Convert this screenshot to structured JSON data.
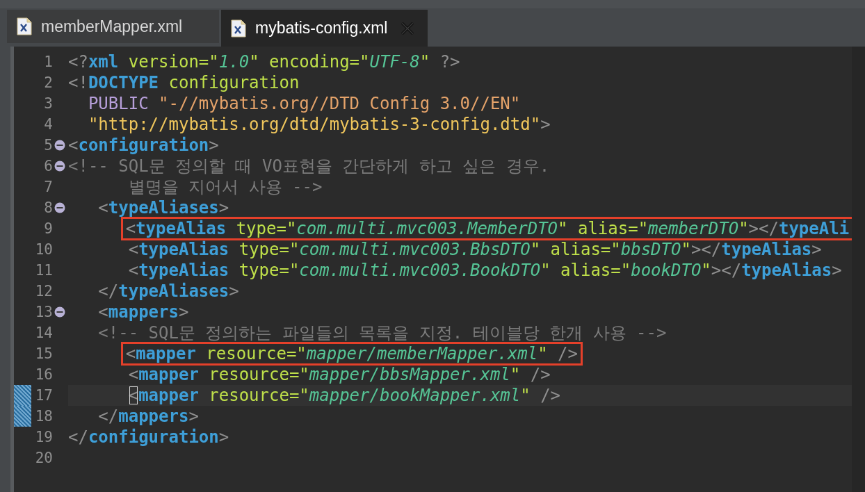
{
  "tabs": [
    {
      "label": "memberMapper.xml",
      "selected": false
    },
    {
      "label": "mybatis-config.xml",
      "selected": true
    }
  ],
  "editor": {
    "lines": [
      {
        "number": "1",
        "tokens": [
          {
            "kind": "punct",
            "text": "<?"
          },
          {
            "kind": "tag",
            "text": "xml"
          },
          {
            "kind": "attr",
            "text": " version=\""
          },
          {
            "kind": "value",
            "text": "1.0"
          },
          {
            "kind": "attr",
            "text": "\" encoding=\""
          },
          {
            "kind": "value",
            "text": "UTF-8"
          },
          {
            "kind": "attr",
            "text": "\""
          },
          {
            "kind": "punct",
            "text": " ?>"
          }
        ]
      },
      {
        "number": "2",
        "tokens": [
          {
            "kind": "punct",
            "text": "<!"
          },
          {
            "kind": "tag",
            "text": "DOCTYPE"
          },
          {
            "kind": "attr",
            "text": " configuration"
          }
        ]
      },
      {
        "number": "3",
        "tokens": [
          {
            "kind": "keyword",
            "text": "  PUBLIC"
          },
          {
            "kind": "pubid",
            "text": " \"-//mybatis.org//DTD Config 3.0//EN\""
          }
        ]
      },
      {
        "number": "4",
        "tokens": [
          {
            "kind": "sysid",
            "text": "  \"http://mybatis.org/dtd/mybatis-3-config.dtd\""
          },
          {
            "kind": "punct",
            "text": ">"
          }
        ]
      },
      {
        "number": "5",
        "foldable": true,
        "tokens": [
          {
            "kind": "punct",
            "text": "<"
          },
          {
            "kind": "tag",
            "text": "configuration"
          },
          {
            "kind": "punct",
            "text": ">"
          }
        ]
      },
      {
        "number": "6",
        "foldable": true,
        "tokens": [
          {
            "kind": "comment",
            "text": "<!-- SQL문 정의할 때 VO표현을 간단하게 하고 싶은 경우."
          }
        ]
      },
      {
        "number": "7",
        "tokens": [
          {
            "kind": "comment",
            "text": "      별명을 지어서 사용 -->"
          }
        ]
      },
      {
        "number": "8",
        "foldable": true,
        "tokens": [
          {
            "kind": "punct",
            "text": "   <"
          },
          {
            "kind": "tag",
            "text": "typeAliases"
          },
          {
            "kind": "punct",
            "text": ">"
          }
        ]
      },
      {
        "number": "9",
        "highlighted": true,
        "tokens": [
          {
            "kind": "punct",
            "text": "      <"
          },
          {
            "kind": "tag",
            "text": "typeAlias"
          },
          {
            "kind": "attr",
            "text": " type=\""
          },
          {
            "kind": "value",
            "text": "com.multi.mvc003.MemberDTO"
          },
          {
            "kind": "attr",
            "text": "\" alias=\""
          },
          {
            "kind": "value",
            "text": "memberDTO"
          },
          {
            "kind": "attr",
            "text": "\""
          },
          {
            "kind": "punct",
            "text": "></"
          },
          {
            "kind": "tag",
            "text": "typeAli"
          }
        ]
      },
      {
        "number": "10",
        "tokens": [
          {
            "kind": "punct",
            "text": "      <"
          },
          {
            "kind": "tag",
            "text": "typeAlias"
          },
          {
            "kind": "attr",
            "text": " type=\""
          },
          {
            "kind": "value",
            "text": "com.multi.mvc003.BbsDTO"
          },
          {
            "kind": "attr",
            "text": "\" alias=\""
          },
          {
            "kind": "value",
            "text": "bbsDTO"
          },
          {
            "kind": "attr",
            "text": "\""
          },
          {
            "kind": "punct",
            "text": "></"
          },
          {
            "kind": "tag",
            "text": "typeAlias"
          },
          {
            "kind": "punct",
            "text": ">"
          }
        ]
      },
      {
        "number": "11",
        "tokens": [
          {
            "kind": "punct",
            "text": "      <"
          },
          {
            "kind": "tag",
            "text": "typeAlias"
          },
          {
            "kind": "attr",
            "text": " type=\""
          },
          {
            "kind": "value",
            "text": "com.multi.mvc003.BookDTO"
          },
          {
            "kind": "attr",
            "text": "\" alias=\""
          },
          {
            "kind": "value",
            "text": "bookDTO"
          },
          {
            "kind": "attr",
            "text": "\""
          },
          {
            "kind": "punct",
            "text": "></"
          },
          {
            "kind": "tag",
            "text": "typeAlias"
          },
          {
            "kind": "punct",
            "text": ">"
          }
        ]
      },
      {
        "number": "12",
        "tokens": [
          {
            "kind": "punct",
            "text": "   </"
          },
          {
            "kind": "tag",
            "text": "typeAliases"
          },
          {
            "kind": "punct",
            "text": ">"
          }
        ]
      },
      {
        "number": "13",
        "foldable": true,
        "tokens": [
          {
            "kind": "punct",
            "text": "   <"
          },
          {
            "kind": "tag",
            "text": "mappers"
          },
          {
            "kind": "punct",
            "text": ">"
          }
        ]
      },
      {
        "number": "14",
        "tokens": [
          {
            "kind": "comment",
            "text": "   <!-- SQL문 정의하는 파일들의 목록을 지정. 테이블당 한개 사용 -->"
          }
        ]
      },
      {
        "number": "15",
        "highlighted": true,
        "tokens": [
          {
            "kind": "punct",
            "text": "      <"
          },
          {
            "kind": "tag",
            "text": "mapper"
          },
          {
            "kind": "attr",
            "text": " resource=\""
          },
          {
            "kind": "value",
            "text": "mapper/memberMapper.xml"
          },
          {
            "kind": "attr",
            "text": "\""
          },
          {
            "kind": "punct",
            "text": " />"
          }
        ]
      },
      {
        "number": "16",
        "tokens": [
          {
            "kind": "punct",
            "text": "      <"
          },
          {
            "kind": "tag",
            "text": "mapper"
          },
          {
            "kind": "attr",
            "text": " resource=\""
          },
          {
            "kind": "value",
            "text": "mapper/bbsMapper.xml"
          },
          {
            "kind": "attr",
            "text": "\""
          },
          {
            "kind": "punct",
            "text": " />"
          }
        ]
      },
      {
        "number": "17",
        "current": true,
        "changed": true,
        "tokens": [
          {
            "kind": "match",
            "text": "      <"
          },
          {
            "kind": "tag",
            "text": "mapper"
          },
          {
            "kind": "attr",
            "text": " resource=\""
          },
          {
            "kind": "value",
            "text": "mapper/bookMapper.xml"
          },
          {
            "kind": "attr",
            "text": "\""
          },
          {
            "kind": "punct",
            "text": " />"
          }
        ]
      },
      {
        "number": "18",
        "changed": true,
        "tokens": [
          {
            "kind": "punct",
            "text": "   </"
          },
          {
            "kind": "tag",
            "text": "mappers"
          },
          {
            "kind": "punct",
            "text": ">"
          }
        ]
      },
      {
        "number": "19",
        "tokens": [
          {
            "kind": "punct",
            "text": "</"
          },
          {
            "kind": "tag",
            "text": "configuration"
          },
          {
            "kind": "punct",
            "text": ">"
          }
        ]
      },
      {
        "number": "20"
      }
    ]
  }
}
